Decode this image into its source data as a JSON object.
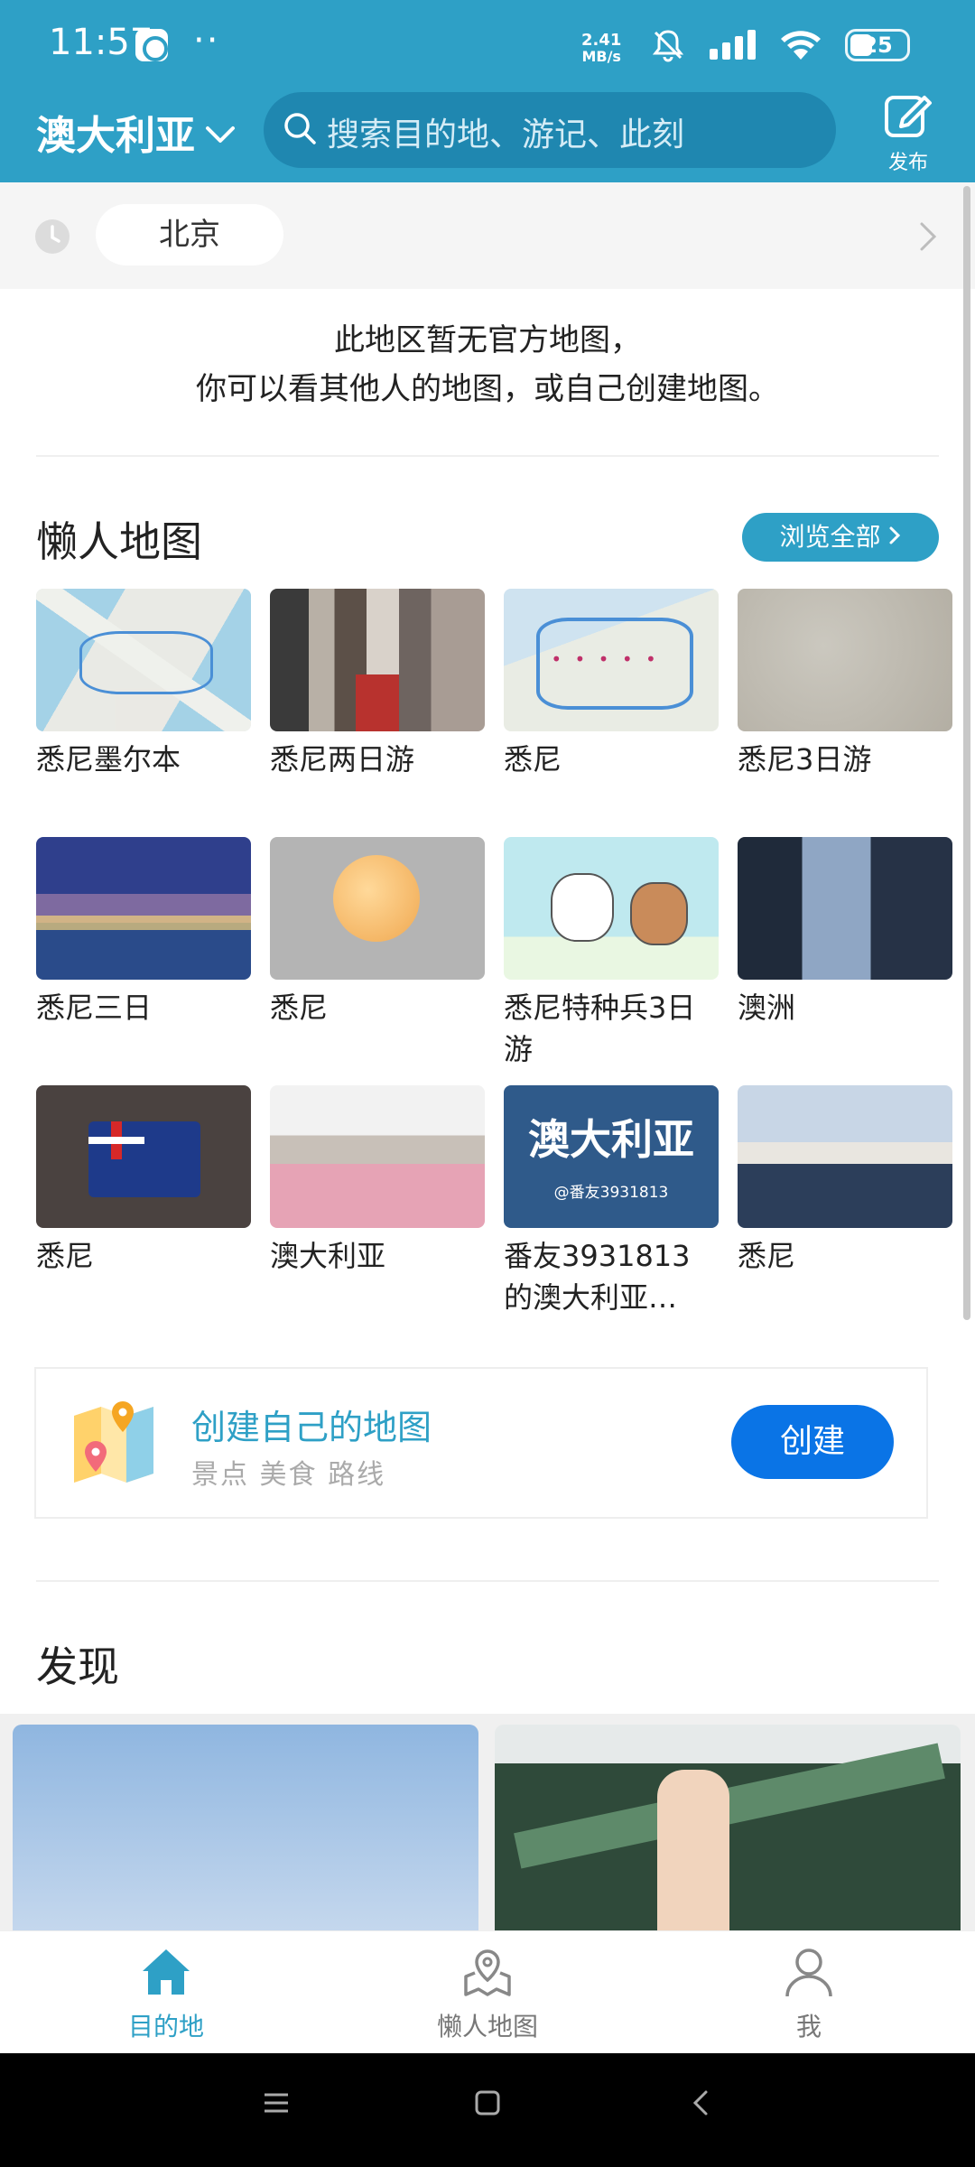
{
  "status_bar": {
    "time": "11:57",
    "dots": "··",
    "net_speed": "2.41",
    "net_unit": "MB/s",
    "battery": "25"
  },
  "topbar": {
    "region": "澳大利亚",
    "search_placeholder": "搜索目的地、游记、此刻",
    "publish_label": "发布"
  },
  "history": {
    "chip": "北京"
  },
  "notice": {
    "line1": "此地区暂无官方地图，",
    "line2": "你可以看其他人的地图，或自己创建地图。"
  },
  "lazy_maps": {
    "title": "懒人地图",
    "browse_all": "浏览全部",
    "cards": [
      {
        "label": "悉尼墨尔本",
        "thumb": "map"
      },
      {
        "label": "悉尼两日游",
        "thumb": "street"
      },
      {
        "label": "悉尼",
        "thumb": "map2"
      },
      {
        "label": "悉尼3日游",
        "thumb": "paper"
      },
      {
        "label": "悉尼三日",
        "thumb": "opera"
      },
      {
        "label": "悉尼",
        "thumb": "moon"
      },
      {
        "label": "悉尼特种兵3日游",
        "thumb": "cartoon"
      },
      {
        "label": "澳洲",
        "thumb": "tower"
      },
      {
        "label": "悉尼",
        "thumb": "flag"
      },
      {
        "label": "澳大利亚",
        "thumb": "tulip"
      },
      {
        "label": "番友3931813的澳大利亚…",
        "thumb": "text",
        "thumb_text": "澳大利亚",
        "thumb_sub": "@番友3931813"
      },
      {
        "label": "悉尼",
        "thumb": "harbor"
      }
    ]
  },
  "create_card": {
    "title": "创建自己的地图",
    "subtitle": "景点 美食 路线",
    "button": "创建"
  },
  "discover": {
    "title": "发现"
  },
  "bottom_nav": {
    "items": [
      {
        "label": "目的地",
        "active": true
      },
      {
        "label": "懒人地图",
        "active": false
      },
      {
        "label": "我",
        "active": false
      }
    ]
  },
  "colors": {
    "accent": "#2ea0c6",
    "create_button": "#0a74e6"
  }
}
